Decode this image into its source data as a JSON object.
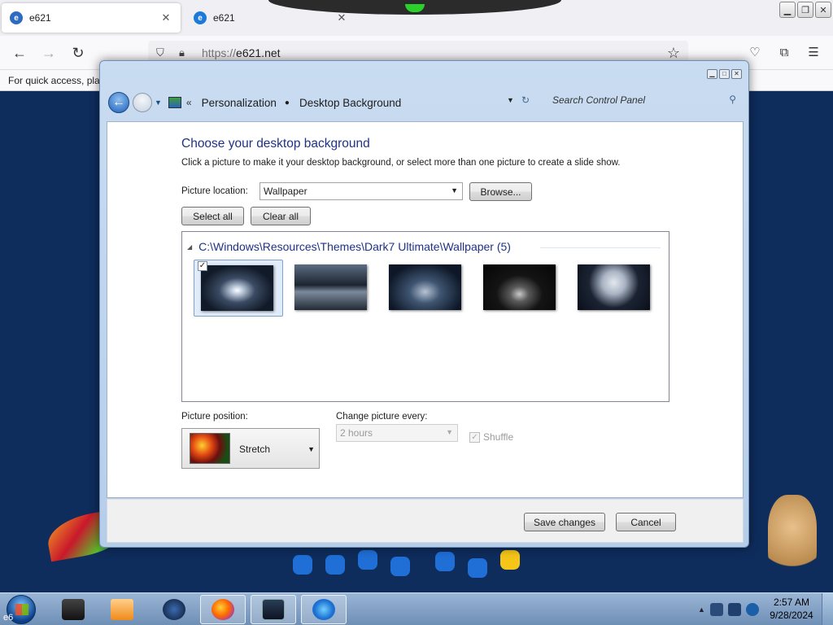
{
  "browser": {
    "tabs": [
      {
        "title": "e621",
        "favicon": "e621-favicon",
        "active": true
      },
      {
        "title": "e621",
        "favicon": "ie-favicon",
        "active": false
      }
    ],
    "url_scheme": "https://",
    "url_host": "e621.net",
    "bookmarks_hint": "For quick access, plac"
  },
  "control_panel": {
    "breadcrumb": [
      "Personalization",
      "Desktop Background"
    ],
    "search_placeholder": "Search Control Panel",
    "heading": "Choose your desktop background",
    "description": "Click a picture to make it your desktop background, or select more than one picture to create a slide show.",
    "picture_location_label": "Picture location:",
    "picture_location_value": "Wallpaper",
    "browse_label": "Browse...",
    "select_all_label": "Select all",
    "clear_all_label": "Clear all",
    "group_title": "C:\\Windows\\Resources\\Themes\\Dark7 Ultimate\\Wallpaper (5)",
    "thumbnails": [
      {
        "name": "wallpaper-1",
        "checked": true
      },
      {
        "name": "wallpaper-2",
        "checked": false
      },
      {
        "name": "wallpaper-3",
        "checked": false
      },
      {
        "name": "wallpaper-4",
        "checked": false
      },
      {
        "name": "wallpaper-5",
        "checked": false
      }
    ],
    "picture_position_label": "Picture position:",
    "picture_position_value": "Stretch",
    "change_every_label": "Change picture every:",
    "change_every_value": "2 hours",
    "shuffle_label": "Shuffle",
    "save_label": "Save changes",
    "cancel_label": "Cancel"
  },
  "taskbar": {
    "start_text": "e6",
    "clock_time": "2:57 AM",
    "clock_date": "9/28/2024"
  }
}
